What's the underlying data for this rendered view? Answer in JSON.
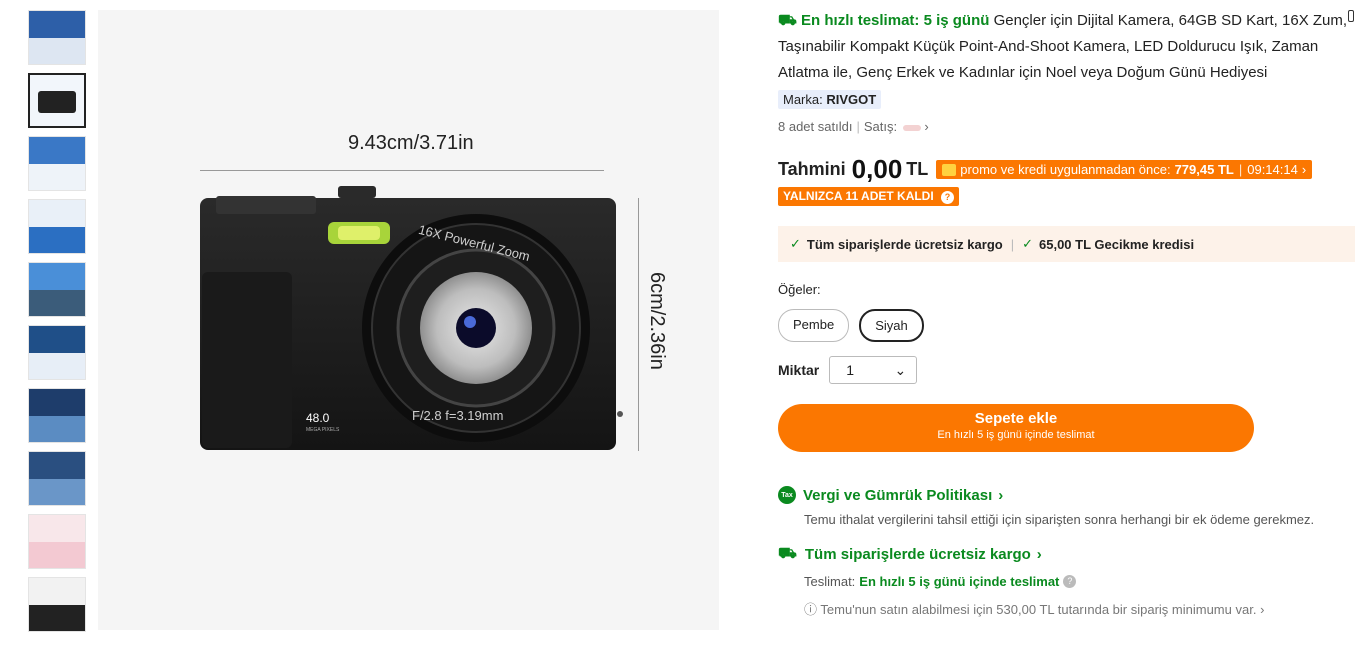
{
  "title": {
    "fast_label": "En hızlı teslimat: 5 iş günü",
    "text": "Gençler için Dijital Kamera, 64GB SD Kart, 16X Zum, Taşınabilir Kompakt Küçük Point-And-Shoot Kamera, LED Doldurucu Işık, Zaman Atlatma ile, Genç Erkek ve Kadınlar için Noel veya Doğum Günü Hediyesi"
  },
  "brand": {
    "label": "Marka:",
    "value": "RIVGOT"
  },
  "sold": {
    "count": "8 adet satıldı",
    "seller_label": "Satış:"
  },
  "price": {
    "label": "Tahmini",
    "value": "0,00",
    "currency": "TL",
    "promo_text": "promo ve kredi uygulanmadan önce:",
    "promo_price": "779,45 TL",
    "timer": "09:14:14",
    "stock_badge": "YALNIZCA 11 ADET KALDI"
  },
  "shipping_box": {
    "item1": "Tüm siparişlerde ücretsiz kargo",
    "item2": "65,00 TL Gecikme kredisi"
  },
  "options": {
    "label": "Öğeler:",
    "items": [
      "Pembe",
      "Siyah"
    ],
    "selected": "Siyah"
  },
  "quantity": {
    "label": "Miktar",
    "value": "1"
  },
  "cart": {
    "label": "Sepete ekle",
    "sub": "En hızlı 5 iş günü içinde teslimat"
  },
  "policy": {
    "tax_icon_text": "Tax",
    "title": "Vergi ve Gümrük Politikası",
    "desc": "Temu ithalat vergilerini tahsil ettiği için siparişten sonra herhangi bir ek ödeme gerekmez."
  },
  "free_shipping": {
    "title": "Tüm siparişlerde ücretsiz kargo",
    "delivery_label": "Teslimat:",
    "delivery_value": "En hızlı 5 iş günü içinde teslimat",
    "minimum": "Temu'nun satın alabilmesi için 530,00 TL tutarında bir sipariş minimumu var."
  },
  "image": {
    "width_label": "9.43cm/3.71in",
    "height_label": "6cm/2.36in",
    "lens_text_top": "16X Powerful Zoom",
    "lens_text_bottom": "F/2.8  f=3.19mm",
    "mp": "48.0",
    "mp_sub": "MEGA PIXELS"
  },
  "colors": {
    "accent": "#fb7701",
    "green": "#0a8a1f",
    "promo_bg": "#fdf2e9"
  }
}
